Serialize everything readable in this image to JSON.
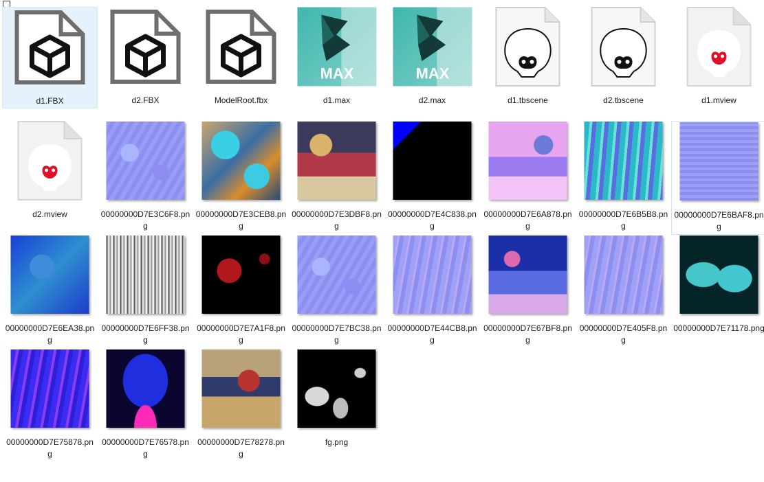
{
  "files": [
    {
      "name": "d1.FBX",
      "type": "fbx",
      "selected": true
    },
    {
      "name": "d2.FBX",
      "type": "fbx"
    },
    {
      "name": "ModelRoot.fbx",
      "type": "fbx"
    },
    {
      "name": "d1.max",
      "type": "max"
    },
    {
      "name": "d2.max",
      "type": "max"
    },
    {
      "name": "d1.tbscene",
      "type": "tbscene"
    },
    {
      "name": "d2.tbscene",
      "type": "tbscene"
    },
    {
      "name": "d1.mview",
      "type": "mview"
    },
    {
      "name": "d2.mview",
      "type": "mview"
    },
    {
      "name": "00000000D7E3C6F8.png",
      "type": "normal"
    },
    {
      "name": "00000000D7E3CEB8.png",
      "type": "color-cyan"
    },
    {
      "name": "00000000D7E3DBF8.png",
      "type": "color-atlas"
    },
    {
      "name": "00000000D7E4C838.png",
      "type": "black-blue"
    },
    {
      "name": "00000000D7E6A878.png",
      "type": "pink-atlas"
    },
    {
      "name": "00000000D7E6B5B8.png",
      "type": "teal-waves"
    },
    {
      "name": "00000000D7E6BAF8.png",
      "type": "normal-dense",
      "hovered": true
    },
    {
      "name": "00000000D7E6EA38.png",
      "type": "blue-atlas"
    },
    {
      "name": "00000000D7E6FF38.png",
      "type": "gray-streaks"
    },
    {
      "name": "00000000D7E7A1F8.png",
      "type": "black-red"
    },
    {
      "name": "00000000D7E7BC38.png",
      "type": "normal"
    },
    {
      "name": "00000000D7E44CB8.png",
      "type": "normal-waves"
    },
    {
      "name": "00000000D7E67BF8.png",
      "type": "blue-atlas2"
    },
    {
      "name": "00000000D7E405F8.png",
      "type": "normal-waves"
    },
    {
      "name": "00000000D7E71178.png",
      "type": "cyan-flames"
    },
    {
      "name": "00000000D7E75878.png",
      "type": "purple-blue"
    },
    {
      "name": "00000000D7E76578.png",
      "type": "blue-magenta"
    },
    {
      "name": "00000000D7E78278.png",
      "type": "color-atlas2"
    },
    {
      "name": "fg.png",
      "type": "black-white"
    }
  ],
  "icons": {
    "fbx": "3d-model-file-icon",
    "max": "3ds-max-icon",
    "tbscene": "toolbag-skull-icon",
    "mview": "marmoset-viewer-icon"
  },
  "colors": {
    "selection_bg": "#e5f1fb",
    "max_teal": "#2a9d98",
    "monkey_red": "#e0102a"
  }
}
